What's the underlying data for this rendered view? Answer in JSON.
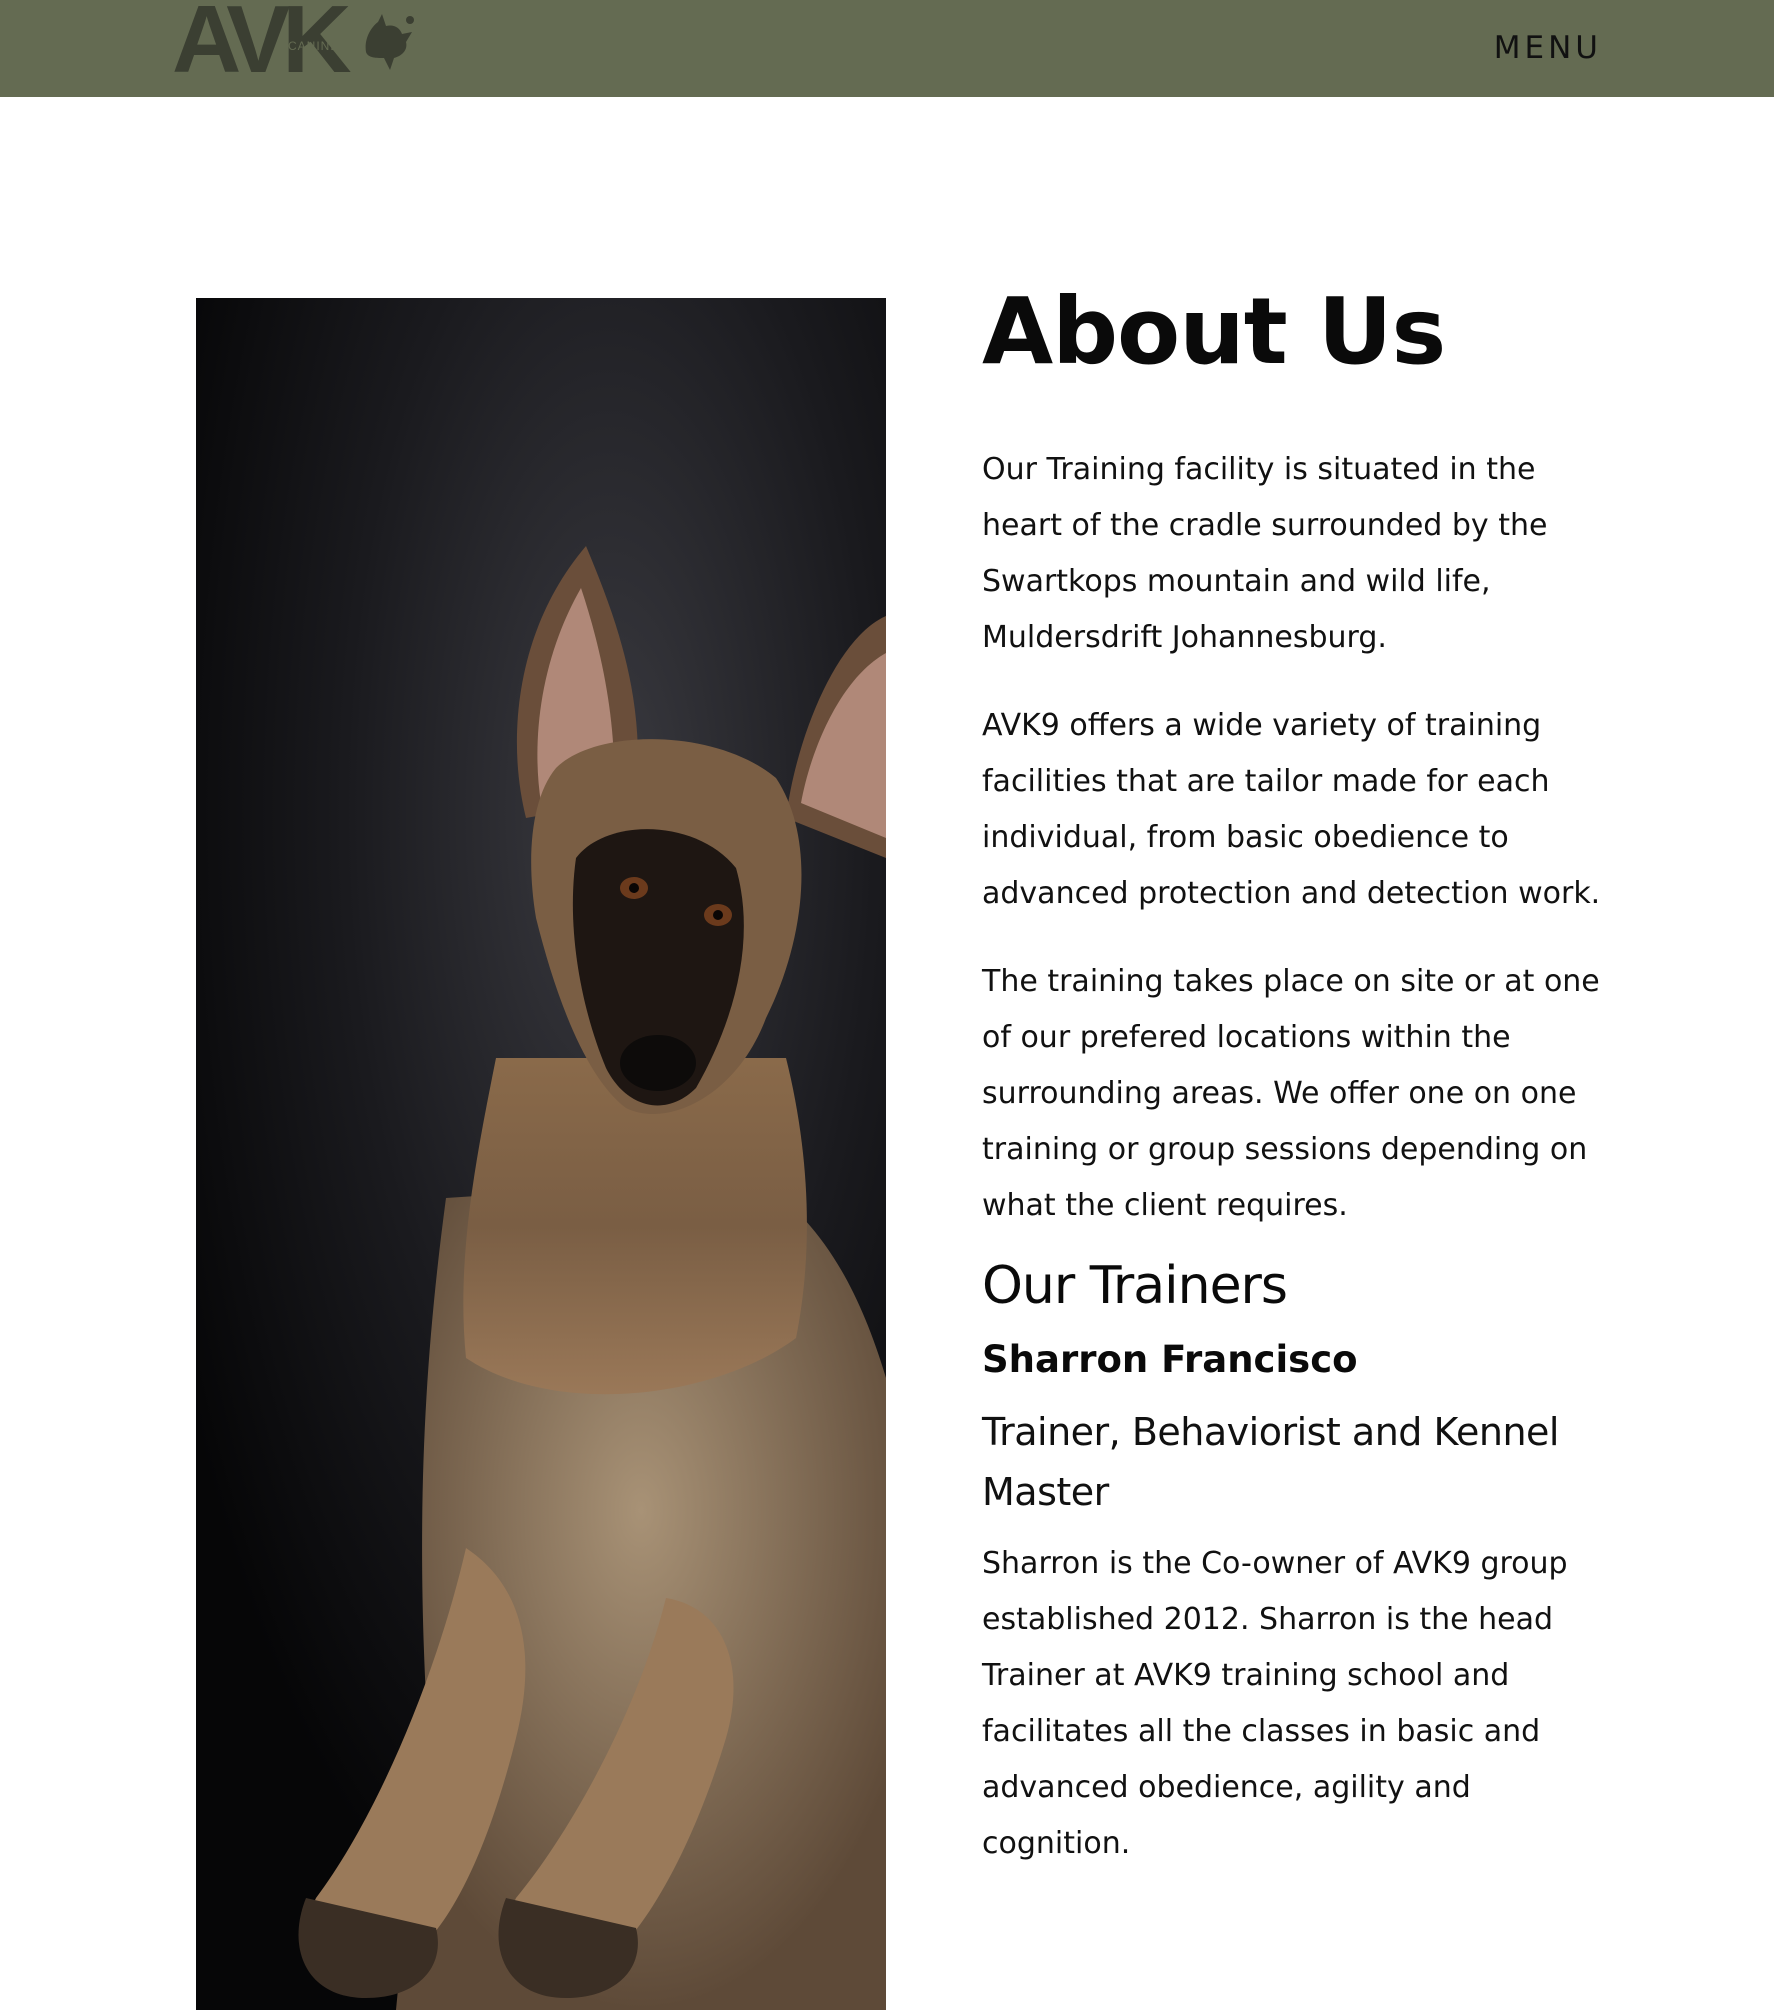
{
  "header": {
    "logo_text": "AVK",
    "logo_subtext": "CANINE",
    "menu_label": "MENU",
    "background_color": "#646b52"
  },
  "hero_image": {
    "description_icon": "dog-photo"
  },
  "main": {
    "title": "About Us",
    "paragraphs": [
      "Our Training facility is situated in the heart of the cradle surrounded by the Swartkops mountain and wild life, Muldersdrift Johannesburg.",
      "AVK9 offers a wide variety of training facilities that are tailor made for each individual, from basic obedience to advanced protection and detection work.",
      "The training takes place on site or at one of our prefered locations within the surrounding areas. We offer one on one training or group sessions depending on what the client requires."
    ],
    "trainers_heading": "Our Trainers",
    "trainer": {
      "name": "Sharron Francisco",
      "role": "Trainer, Behaviorist and Kennel Master",
      "bio": "Sharron is the Co-owner of AVK9 group established 2012. Sharron is the head Trainer at AVK9 training school and facilitates all the classes in basic and advanced obedience, agility and cognition."
    }
  }
}
